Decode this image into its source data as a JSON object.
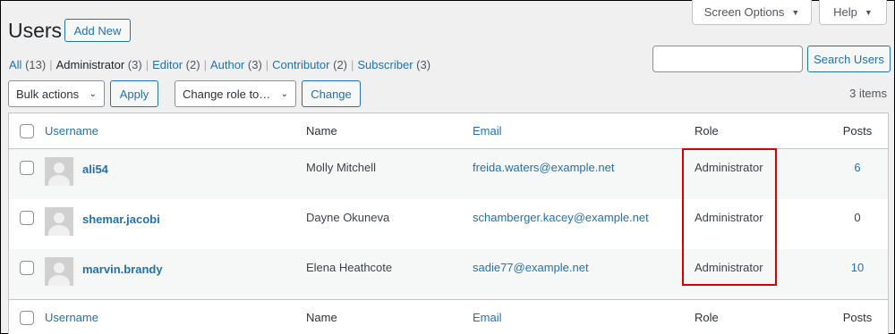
{
  "screen_tabs": {
    "screen_options": "Screen Options",
    "help": "Help"
  },
  "header": {
    "title": "Users",
    "add_new": "Add New"
  },
  "filters": [
    {
      "label": "All",
      "count": "(13)"
    },
    {
      "label": "Administrator",
      "count": "(3)"
    },
    {
      "label": "Editor",
      "count": "(2)"
    },
    {
      "label": "Author",
      "count": "(3)"
    },
    {
      "label": "Contributor",
      "count": "(2)"
    },
    {
      "label": "Subscriber",
      "count": "(3)"
    }
  ],
  "search": {
    "button": "Search Users",
    "value": ""
  },
  "tablenav": {
    "bulk_actions": "Bulk actions",
    "apply": "Apply",
    "change_role": "Change role to…",
    "change": "Change",
    "items": "3 items"
  },
  "columns": {
    "username": "Username",
    "name": "Name",
    "email": "Email",
    "role": "Role",
    "posts": "Posts"
  },
  "rows": [
    {
      "username": "ali54",
      "name": "Molly Mitchell",
      "email": "freida.waters@example.net",
      "role": "Administrator",
      "posts": "6"
    },
    {
      "username": "shemar.jacobi",
      "name": "Dayne Okuneva",
      "email": "schamberger.kacey@example.net",
      "role": "Administrator",
      "posts": "0"
    },
    {
      "username": "marvin.brandy",
      "name": "Elena Heathcote",
      "email": "sadie77@example.net",
      "role": "Administrator",
      "posts": "10"
    }
  ],
  "colors": {
    "link": "#2271b1",
    "highlight": "#d50000"
  }
}
